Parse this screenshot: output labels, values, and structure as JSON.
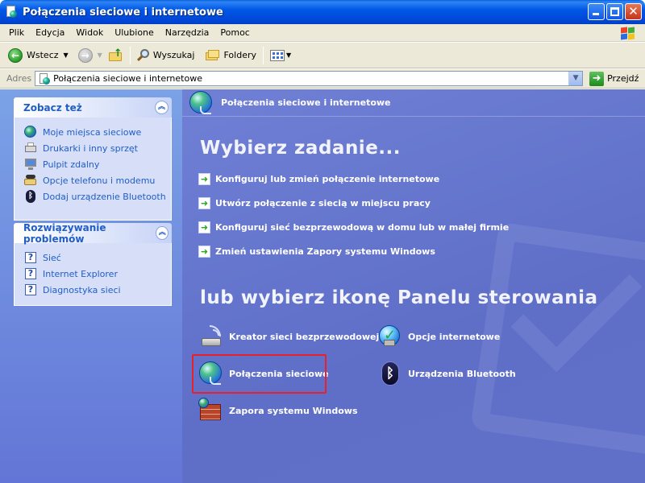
{
  "window": {
    "title": "Połączenia sieciowe i internetowe",
    "accent": "#0054E3"
  },
  "menu": [
    "Plik",
    "Edycja",
    "Widok",
    "Ulubione",
    "Narzędzia",
    "Pomoc"
  ],
  "toolbar": {
    "back_label": "Wstecz",
    "search_label": "Wyszukaj",
    "folders_label": "Foldery"
  },
  "address": {
    "label": "Adres",
    "value": "Połączenia sieciowe i internetowe",
    "go_label": "Przejdź"
  },
  "see_also": {
    "title": "Zobacz też",
    "items": [
      {
        "label": "Moje miejsca sieciowe",
        "icon": "network-places-icon"
      },
      {
        "label": "Drukarki i inny sprzęt",
        "icon": "printer-icon"
      },
      {
        "label": "Pulpit zdalny",
        "icon": "remote-desktop-icon"
      },
      {
        "label": "Opcje telefonu i modemu",
        "icon": "phone-modem-icon"
      },
      {
        "label": "Dodaj urządzenie Bluetooth",
        "icon": "bluetooth-icon"
      }
    ]
  },
  "troubleshoot": {
    "title": "Rozwiązywanie problemów",
    "items": [
      {
        "label": "Sieć",
        "icon": "help-icon"
      },
      {
        "label": "Internet Explorer",
        "icon": "help-icon"
      },
      {
        "label": "Diagnostyka sieci",
        "icon": "help-icon"
      }
    ]
  },
  "main": {
    "header_title": "Połączenia sieciowe i internetowe",
    "task_heading": "Wybierz zadanie...",
    "tasks": [
      "Konfiguruj lub zmień połączenie internetowe",
      "Utwórz połączenie z siecią w miejscu pracy",
      "Konfiguruj sieć bezprzewodową w domu lub w małej firmie",
      "Zmień ustawienia Zapory systemu Windows"
    ],
    "icons_heading": "lub wybierz ikonę Panelu sterowania",
    "control_panel_items": [
      {
        "label": "Kreator sieci bezprzewodowej",
        "icon": "wireless-network-icon"
      },
      {
        "label": "Opcje internetowe",
        "icon": "internet-options-icon"
      },
      {
        "label": "Połączenia sieciowe",
        "icon": "network-connections-icon",
        "highlighted": true
      },
      {
        "label": "Urządzenia Bluetooth",
        "icon": "bluetooth-icon"
      },
      {
        "label": "Zapora systemu Windows",
        "icon": "firewall-icon"
      }
    ]
  },
  "colors": {
    "highlight": "#E8202A",
    "task_pane": "#6375D6",
    "link": "#215DC6"
  }
}
